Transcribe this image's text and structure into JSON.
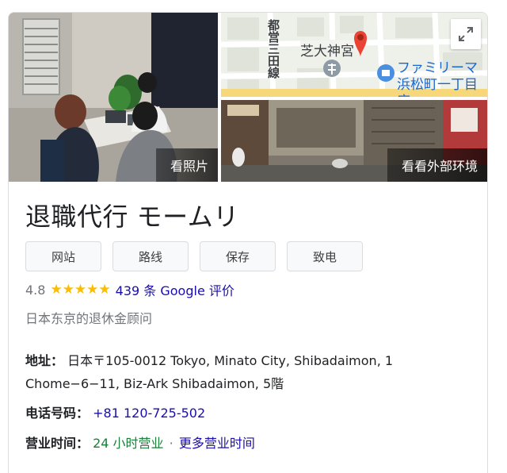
{
  "photos": {
    "main_label": "看照片",
    "street_label": "看看外部环境"
  },
  "map": {
    "road_label": "都営三田線",
    "shrine_label": "芝大神宮",
    "store_line1": "ファミリーマ",
    "store_line2": "浜松町一丁目店"
  },
  "business": {
    "name": "退職代行 モームリ",
    "actions": [
      "网站",
      "路线",
      "保存",
      "致电"
    ],
    "rating": "4.8",
    "stars": "★★★★★",
    "reviews": "439 条 Google 评价",
    "category": "日本东京的退休金顾问",
    "address_label": "地址：",
    "address_line1": "日本〒105-0012 Tokyo, Minato City, Shibadaimon, 1",
    "address_line2": "Chome−6−11, Biz-Ark Shibadaimon, 5階",
    "phone_label": "电话号码：",
    "phone": "+81 120-725-502",
    "hours_label": "营业时间：",
    "hours_status": "24 小时营业",
    "hours_sep": "·",
    "hours_more": "更多营业时间"
  },
  "colors": {
    "link": "#1a0dab",
    "open": "#188038",
    "star": "#fbbc04",
    "pin": "#ea4335"
  }
}
